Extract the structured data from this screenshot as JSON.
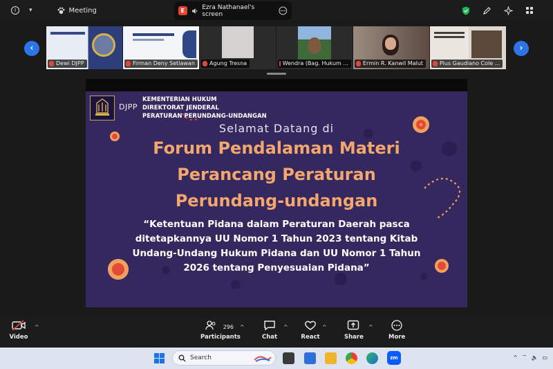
{
  "topbar": {
    "info_icon": "info-icon",
    "meeting_label": "Meeting",
    "share_badge": "E",
    "share_label": "Ezra Nathanael's screen"
  },
  "participants_strip": [
    {
      "name": "Dewi DJPP",
      "muted": true
    },
    {
      "name": "Firman Deny Setiawan",
      "muted": true
    },
    {
      "name": "Agung Tresna",
      "muted": true
    },
    {
      "name": "Wendra (Bag. Hukum ...",
      "muted": true
    },
    {
      "name": "Ermin R. Kanwil Malut",
      "muted": true
    },
    {
      "name": "Pius Gaudiano Cole ...",
      "muted": true
    }
  ],
  "slide": {
    "ministry_lines": [
      "KEMENTERIAN HUKUM",
      "DIREKTORAT JENDERAL",
      "PERATURAN PERUNDANG-UNDANGAN"
    ],
    "djpp": "DJPP",
    "greeting": "Selamat Datang di",
    "title_lines": [
      "Forum Pendalaman Materi",
      "Perancang Peraturan",
      "Perundang-undangan"
    ],
    "quote_lines": [
      "“Ketentuan Pidana dalam Peraturan Daerah pasca",
      "ditetapkannya UU Nomor 1 Tahun 2023 tentang Kitab",
      "Undang-Undang Hukum Pidana dan UU Nomor 1 Tahun",
      "2026 tentang Penyesuaian Pidana”"
    ],
    "colors": {
      "background": "#34285e",
      "title": "#f3a76c",
      "accent": "#e8583a"
    }
  },
  "toolbar": {
    "video": "Video",
    "participants": "Participants",
    "participants_count": "296",
    "chat": "Chat",
    "react": "React",
    "share": "Share",
    "more": "More"
  },
  "taskbar": {
    "search_placeholder": "Search"
  }
}
